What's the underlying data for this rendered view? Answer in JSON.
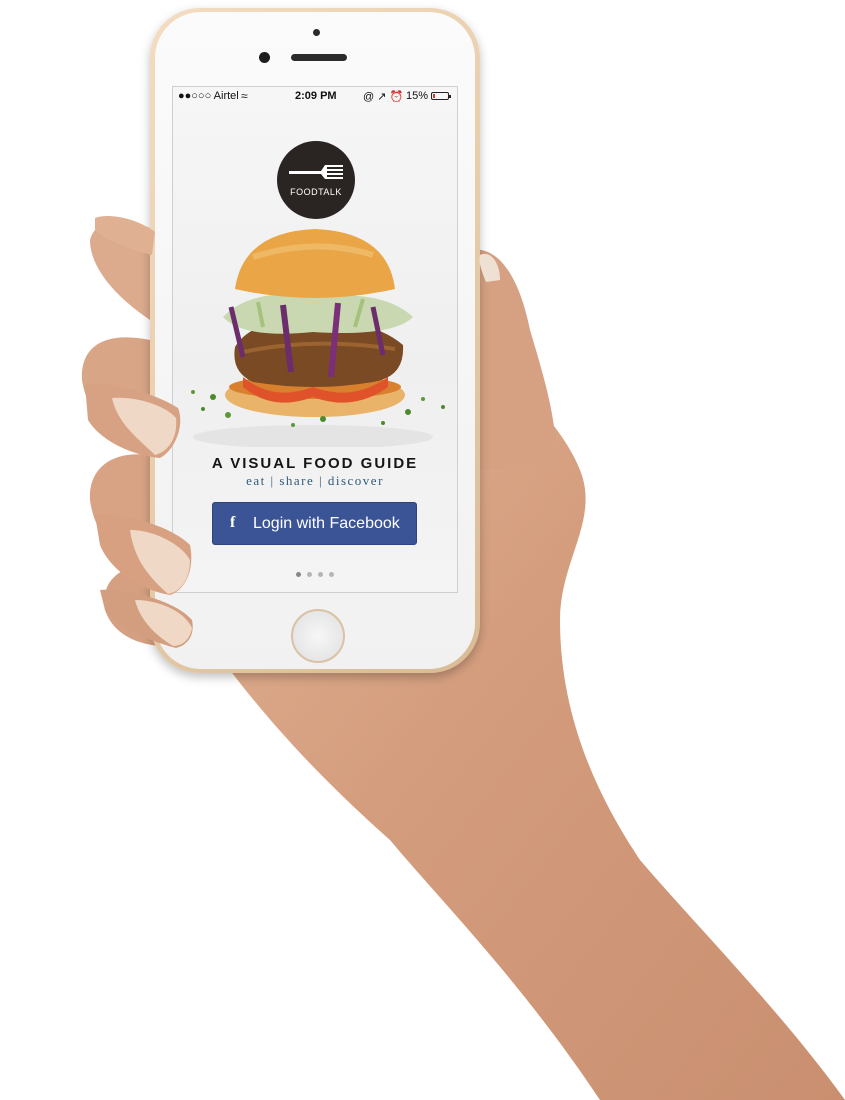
{
  "status_bar": {
    "carrier": "●●○○○ Airtel",
    "wifi_icon": "wifi-icon",
    "time": "2:09 PM",
    "right_icons": "@ ↗ ⏰",
    "battery_percent": "15%",
    "battery_level": 0.15
  },
  "logo": {
    "text": "FOODTALK"
  },
  "headline": "A VISUAL FOOD GUIDE",
  "subheadline": "eat | share | discover",
  "login_button": {
    "icon": "f",
    "label": "Login with Facebook"
  },
  "pager": {
    "count": 4,
    "active_index": 0
  },
  "colors": {
    "facebook_blue": "#3b5495",
    "subline_blue": "#2f5c7c",
    "logo_dark": "#2a2522",
    "phone_gold": "#e9cfae",
    "skin": "#d9a787"
  }
}
